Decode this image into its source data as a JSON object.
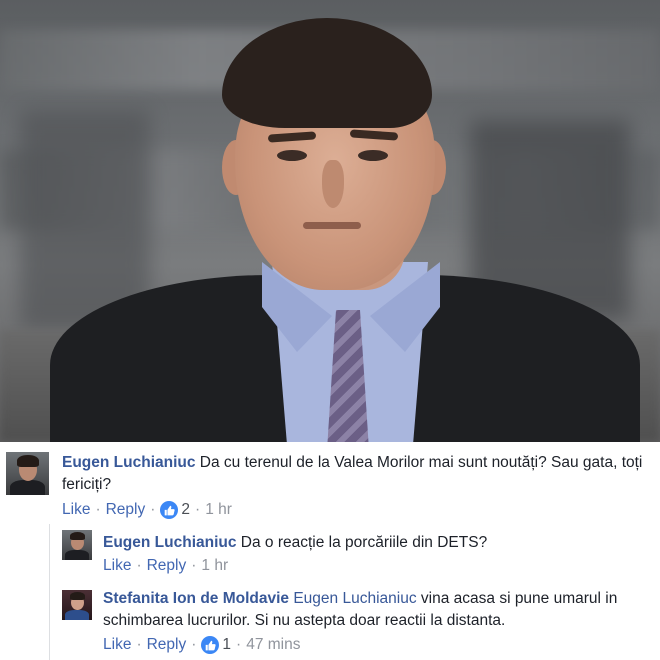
{
  "comments": [
    {
      "author": "Eugen Luchianiuc",
      "mention": "",
      "text": "Da cu terenul de la Valea Morilor mai sunt noutăți? Sau gata, toți fericiți?",
      "like_label": "Like",
      "reply_label": "Reply",
      "reaction_count": "2",
      "time": "1 hr"
    },
    {
      "author": "Eugen Luchianiuc",
      "mention": "",
      "text": "Da o reacție la porcăriile din DETS?",
      "like_label": "Like",
      "reply_label": "Reply",
      "reaction_count": "",
      "time": "1 hr"
    },
    {
      "author": "Stefanita Ion de Moldavie",
      "mention": "Eugen Luchianiuc",
      "text": "vina acasa si pune umarul in schimbarea lucrurilor. Si nu astepta doar reactii la distanta.",
      "like_label": "Like",
      "reply_label": "Reply",
      "reaction_count": "1",
      "time": "47 mins"
    }
  ],
  "colors": {
    "author_link": "#385898",
    "action_link": "#4267b2",
    "meta_gray": "#90949c",
    "like_blue": "#3b87f5"
  },
  "icons": [
    "like-thumb-icon"
  ]
}
